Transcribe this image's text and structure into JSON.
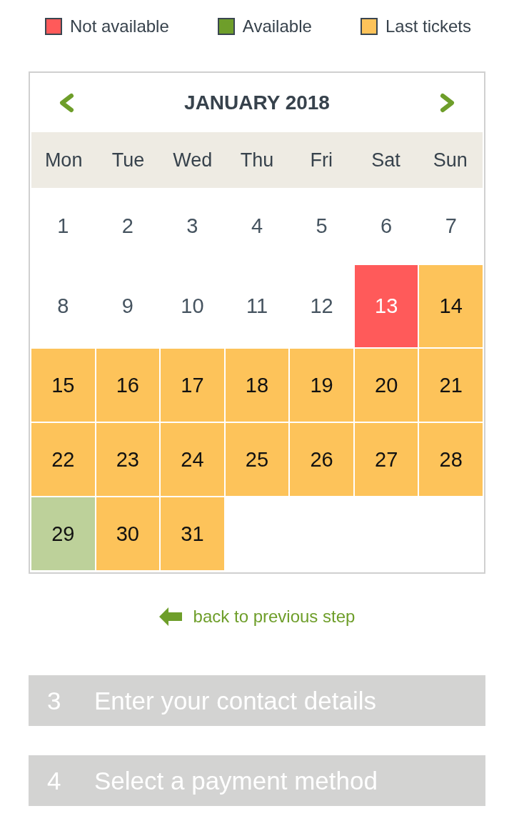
{
  "legend": [
    {
      "label": "Not available",
      "color": "#ff5a5a"
    },
    {
      "label": "Available",
      "color": "#6e9e2a"
    },
    {
      "label": "Last tickets",
      "color": "#fdc35a"
    }
  ],
  "calendar": {
    "title": "JANUARY 2018",
    "weekdays": [
      "Mon",
      "Tue",
      "Wed",
      "Thu",
      "Fri",
      "Sat",
      "Sun"
    ],
    "days": [
      {
        "day": "1",
        "kind": "plain"
      },
      {
        "day": "2",
        "kind": "plain"
      },
      {
        "day": "3",
        "kind": "plain"
      },
      {
        "day": "4",
        "kind": "plain"
      },
      {
        "day": "5",
        "kind": "plain"
      },
      {
        "day": "6",
        "kind": "plain"
      },
      {
        "day": "7",
        "kind": "plain"
      },
      {
        "day": "8",
        "kind": "plain"
      },
      {
        "day": "9",
        "kind": "plain"
      },
      {
        "day": "10",
        "kind": "plain"
      },
      {
        "day": "11",
        "kind": "plain"
      },
      {
        "day": "12",
        "kind": "plain"
      },
      {
        "day": "13",
        "kind": "unavailable"
      },
      {
        "day": "14",
        "kind": "last"
      },
      {
        "day": "15",
        "kind": "last"
      },
      {
        "day": "16",
        "kind": "last"
      },
      {
        "day": "17",
        "kind": "last"
      },
      {
        "day": "18",
        "kind": "last"
      },
      {
        "day": "19",
        "kind": "last"
      },
      {
        "day": "20",
        "kind": "last"
      },
      {
        "day": "21",
        "kind": "last"
      },
      {
        "day": "22",
        "kind": "last"
      },
      {
        "day": "23",
        "kind": "last"
      },
      {
        "day": "24",
        "kind": "last"
      },
      {
        "day": "25",
        "kind": "last"
      },
      {
        "day": "26",
        "kind": "last"
      },
      {
        "day": "27",
        "kind": "last"
      },
      {
        "day": "28",
        "kind": "last"
      },
      {
        "day": "29",
        "kind": "available"
      },
      {
        "day": "30",
        "kind": "last"
      },
      {
        "day": "31",
        "kind": "last"
      }
    ]
  },
  "back_link": {
    "label": "back to previous step"
  },
  "steps": [
    {
      "number": "3",
      "title": "Enter your contact details",
      "disabled": true
    },
    {
      "number": "4",
      "title": "Select a payment method",
      "disabled": true
    }
  ]
}
